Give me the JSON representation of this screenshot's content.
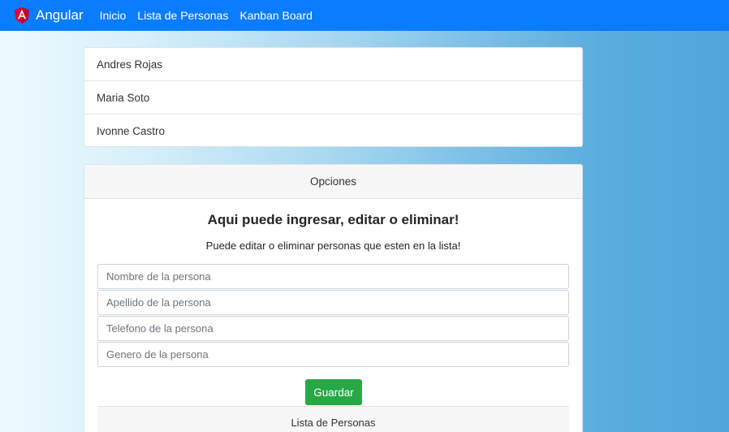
{
  "navbar": {
    "brand": "Angular",
    "links": [
      "Inicio",
      "Lista de Personas",
      "Kanban Board"
    ],
    "background": "#0a7cff",
    "logo_color": "#dd0031"
  },
  "people": [
    "Andres Rojas",
    "Maria Soto",
    "Ivonne Castro"
  ],
  "options": {
    "header": "Opciones",
    "title": "Aqui puede ingresar, editar o eliminar!",
    "subtitle": "Puede editar o eliminar personas que esten en la lista!",
    "fields": {
      "nombre_placeholder": "Nombre de la persona",
      "apellido_placeholder": "Apellido de la persona",
      "telefono_placeholder": "Telefono de la persona",
      "genero_placeholder": "Genero de la persona"
    },
    "save_label": "Guardar",
    "save_color": "#28a745",
    "list_header": "Lista de Personas"
  }
}
